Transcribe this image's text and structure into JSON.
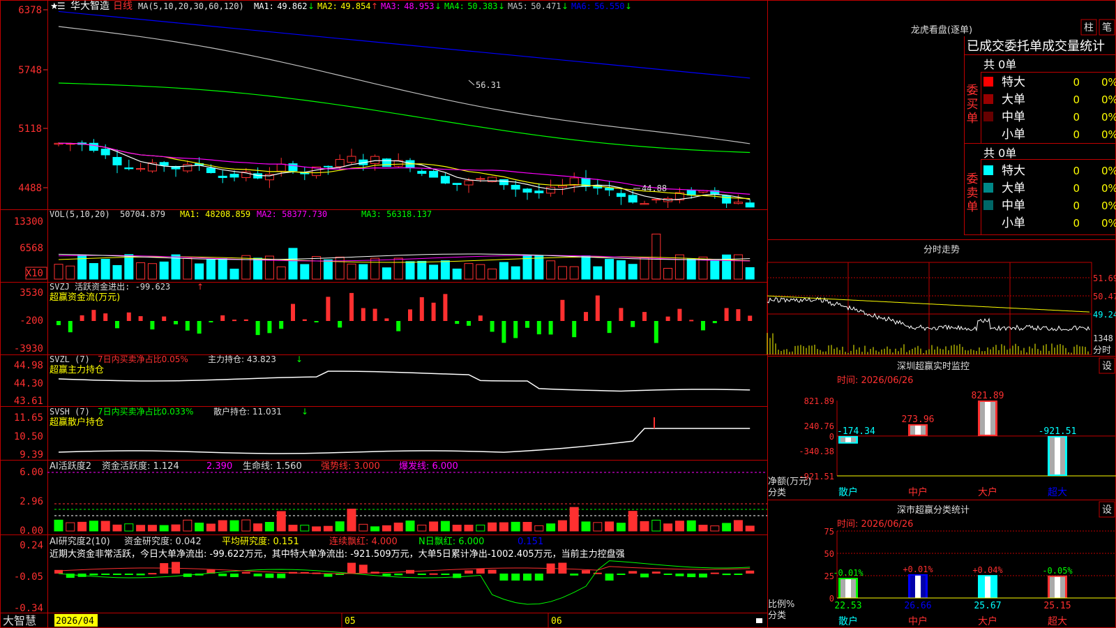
{
  "stock": {
    "name": "华大智造",
    "period": "日线"
  },
  "main_header": {
    "prefix": "MA(5,10,20,30,60,120)",
    "items": [
      {
        "label": "MA1:",
        "value": "49.862",
        "arrow": "↓",
        "color": "#ffffff"
      },
      {
        "label": "MA2:",
        "value": "49.854",
        "arrow": "↑",
        "color": "#ffff00"
      },
      {
        "label": "MA3:",
        "value": "48.953",
        "arrow": "↓",
        "color": "#ff00ff"
      },
      {
        "label": "MA4:",
        "value": "50.383",
        "arrow": "↓",
        "color": "#00ff00"
      },
      {
        "label": "MA5:",
        "value": "50.471",
        "arrow": "↓",
        "color": "#c0c0c0"
      },
      {
        "label": "MA6:",
        "value": "56.550",
        "arrow": "↓",
        "color": "#0000ff"
      }
    ]
  },
  "price_axis": [
    "6378",
    "5748",
    "5118",
    "4488"
  ],
  "annotations": {
    "high": "56.31",
    "low": "44.88"
  },
  "vol_header": {
    "prefix": "VOL(5,10,20)",
    "value": "50704.879",
    "ma1": "MA1: 48208.859",
    "ma2": "MA2: 58377.730",
    "ma3": "MA3: 56318.137"
  },
  "vol_axis": [
    "13300",
    "6568",
    "X10"
  ],
  "svzj": {
    "line1": "SVZJ  活跃资金进出: -99.623",
    "arrow": "↑",
    "line2": "超赢资金流(万元)",
    "axis": [
      "3530",
      "-200",
      "-3930"
    ]
  },
  "svzl": {
    "l1": "SVZL (7)",
    "l2": "7日内买卖净占比0.05%",
    "l3": "主力持仓: 43.823",
    "arrow": "↓",
    "line2": "超赢主力持仓",
    "axis": [
      "44.98",
      "44.30",
      "43.61"
    ]
  },
  "svsh": {
    "l1": "SVSH (7)",
    "l2": "7日内买卖净占比0.033%",
    "l3": "散户持仓: 11.031",
    "arrow": "↓",
    "line2": "超赢散户持仓",
    "axis": [
      "11.65",
      "10.50",
      "9.39"
    ]
  },
  "ai1": {
    "l1": "AI活跃度2",
    "l2": "资金活跃度: 1.124",
    "l3": "2.390",
    "l4": "生命线: 1.560",
    "l5": "强势线: 3.000",
    "l6": "爆发线: 6.000",
    "axis": [
      "6.00",
      "2.96",
      "0.00"
    ]
  },
  "ai2": {
    "l1": "AI研究度2(10)",
    "l2": "资金研究度: 0.042",
    "l3": "平均研究度: 0.151",
    "l4": "连续飘红: 4.000",
    "l5": "N日飘红: 6.000",
    "l6": "0.151",
    "axis": [
      "0.24",
      "-0.05",
      "-0.34"
    ],
    "text": "近期大资金非常活跃，今日大单净流出: -99.622万元，其中特大单净流出: -921.509万元，大单5日累计净出-1002.405万元，当前主力控盘强"
  },
  "date_axis": {
    "logo": "大智慧",
    "labels": [
      "2026/04",
      "05",
      "06"
    ]
  },
  "dragon": {
    "title": "龙虎看盘(逐单)",
    "btn1": "柱",
    "btn2": "笔",
    "subtitle": "已成交委托单成交量统计",
    "buy": {
      "side": "委买单",
      "total": "共 0单",
      "rows": [
        {
          "name": "特大",
          "count": "0",
          "pct": "0%",
          "color": "#ff0000"
        },
        {
          "name": "大单",
          "count": "0",
          "pct": "0%",
          "color": "#990000"
        },
        {
          "name": "中单",
          "count": "0",
          "pct": "0%",
          "color": "#660000"
        },
        {
          "name": "小单",
          "count": "0",
          "pct": "0%",
          "color": "#000000"
        }
      ]
    },
    "sell": {
      "side": "委卖单",
      "total": "共 0单",
      "rows": [
        {
          "name": "特大",
          "count": "0",
          "pct": "0%",
          "color": "#00ffff"
        },
        {
          "name": "大单",
          "count": "0",
          "pct": "0%",
          "color": "#008888"
        },
        {
          "name": "中单",
          "count": "0",
          "pct": "0%",
          "color": "#006666"
        },
        {
          "name": "小单",
          "count": "0",
          "pct": "0%",
          "color": "#000000"
        }
      ]
    }
  },
  "intraday": {
    "title": "分时走势",
    "axis": [
      "51.69",
      "50.47",
      "49.24"
    ],
    "vol_label": "1348",
    "unit": "分时"
  },
  "sz_monitor": {
    "title": "深圳超赢实时监控",
    "time": "时间: 2026/06/26",
    "btn": "设",
    "axis": [
      "821.89",
      "240.76",
      "0",
      "-340.38",
      "-921.51"
    ],
    "ylabel": "净额(万元)",
    "xlabel": "分类",
    "categories": [
      "散户",
      "中户",
      "大户",
      "超大"
    ],
    "values": [
      "-174.34",
      "273.96",
      "821.89",
      "-921.51"
    ]
  },
  "sz_stats": {
    "title": "深市超赢分类统计",
    "time": "时间: 2026/06/26",
    "btn": "设",
    "axis": [
      "75",
      "50",
      "25",
      "0"
    ],
    "ylabel": "比例%",
    "xlabel": "分类",
    "categories": [
      "散户",
      "中户",
      "大户",
      "超大"
    ],
    "changes": [
      "-0.01%",
      "+0.01%",
      "+0.04%",
      "-0.05%"
    ],
    "values": [
      "22.53",
      "26.66",
      "25.67",
      "25.15"
    ]
  },
  "chart_data": [
    {
      "type": "bar",
      "title": "深圳超赢实时监控",
      "ylabel": "净额(万元)",
      "xlabel": "分类",
      "categories": [
        "散户",
        "中户",
        "大户",
        "超大"
      ],
      "values": [
        -174.34,
        273.96,
        821.89,
        -921.51
      ],
      "ylim": [
        -921.51,
        821.89
      ]
    },
    {
      "type": "bar",
      "title": "深市超赢分类统计",
      "ylabel": "比例%",
      "xlabel": "分类",
      "categories": [
        "散户",
        "中户",
        "大户",
        "超大"
      ],
      "values": [
        22.53,
        26.66,
        25.67,
        25.15
      ],
      "ylim": [
        0,
        75
      ]
    },
    {
      "type": "line",
      "title": "华大智造 日线",
      "x": [
        "2026/04",
        "05",
        "06"
      ],
      "series": [
        {
          "name": "MA1",
          "values": [
            49.862
          ]
        },
        {
          "name": "MA2",
          "values": [
            49.854
          ]
        },
        {
          "name": "MA3",
          "values": [
            48.953
          ]
        },
        {
          "name": "MA4",
          "values": [
            50.383
          ]
        },
        {
          "name": "MA5",
          "values": [
            50.471
          ]
        },
        {
          "name": "MA6",
          "values": [
            56.55
          ]
        }
      ],
      "ylim": [
        44.88,
        63.78
      ]
    }
  ]
}
